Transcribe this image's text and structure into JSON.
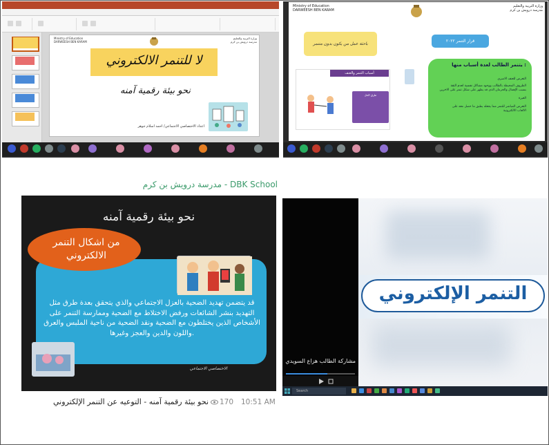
{
  "panel_a": {
    "moe_en_line1": "Ministry of Education",
    "moe_en_line2": "DARWEESH BEN KARAM",
    "moe_ar_line1": "وزارة التربية والتعليم",
    "moe_ar_line2": "مدرسة درويش بن كرم",
    "slide_title": "لا للتنمر الالكتروني",
    "slide_subtitle": "نحو بيئة رقمية آمنه",
    "slide_footer": "اعداد الاختصاصي الاجتماعي/ احمد اسلام جوهر"
  },
  "panel_b": {
    "moe_en_line1": "Ministry of Education",
    "moe_en_line2": "DARWEESH BEN KARAM",
    "moe_ar_line1": "وزارة التربية والتعليم",
    "moe_ar_line2": "مدرسة درويش بن كرم",
    "yellow_box": "باحثة عمل من يكون بدون متنمر",
    "blue_box": "قرار التنمر ٢٠٢٢",
    "green_title": "يتنمر الطالب لعدة أسباب منها :",
    "green_lines": [
      "التعرض للعنف الاسري",
      "الظروف المحيطة بالطالب ووجود مشاكل نفسية لعدم الثقة",
      "بسبب الإهمال والحرمان الذي قد يظهر على شكل تنمر على الاخرين",
      "الغيرة",
      "التعرض المباشر للتنمر مما يجعله يطبق ما حصل معه على",
      "الالعاب الالكترونية"
    ],
    "purple_header": "أسباب التنمر والعنف",
    "purple_panel": "طرق الحل"
  },
  "panel_c": {
    "header": "مدرسة درويش بن كرم - DBK School",
    "slide_title": "نحو بيئة رقمية آمنه",
    "bubble_text": "من اشكال التنمر الالكتروني",
    "paragraph": "قد يتضمن تهديد الضحية بالعزل الاجتماعي والذي يتحقق بعدة طرق مثل التهديد بنشر الشائعات ورفض الاختلاط مع الضحية وممارسة التنمر على الأشخاص الذين يختلطون مع الضحية ونقد الضحية من ناحية الملبس والعرق واللون والدين والعجز وغيرها.",
    "signature": "الاختصاصي الاجتماعي",
    "caption": "نحو بيئة رقمية آمنه - التوعيه عن التنمر الإلكتروني",
    "views": "170",
    "time": "10:51 AM"
  },
  "panel_d": {
    "caption": "مشاركة الطالب هزاع السويدي",
    "progress_fraction": 0.6
  },
  "panel_e": {
    "banner_title": "التنمر الإلكتروني"
  },
  "taskbar": {
    "search_placeholder": "Search"
  },
  "colors": {
    "ppt_red": "#b7472a",
    "slide_yellow": "#f8d35e",
    "green_box": "#62d155",
    "blue_panel": "#2ea8d6",
    "bubble_orange": "#e2611b",
    "dbk_green": "#3a9a6a",
    "banner_blue": "#1c5ea3"
  }
}
